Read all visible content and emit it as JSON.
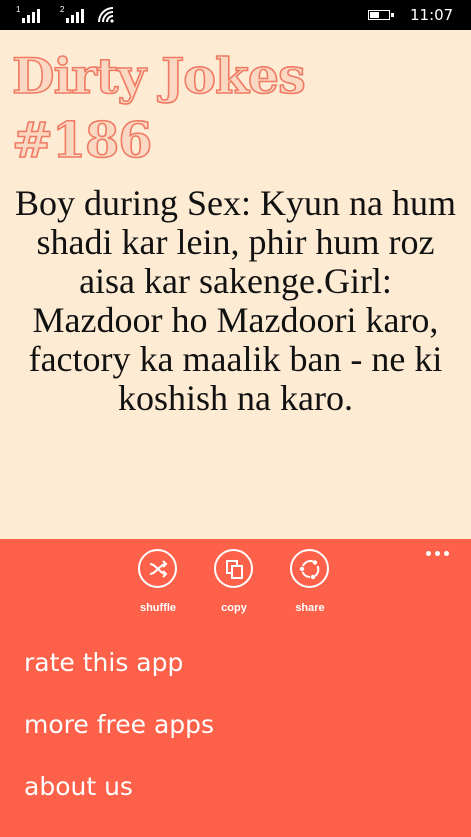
{
  "status_bar": {
    "signal_1_tag": "1",
    "signal_2_tag": "2",
    "time": "11:07"
  },
  "title": "Dirty Jokes #186",
  "joke_text": "Boy during Sex: Kyun na hum shadi kar lein, phir hum roz aisa kar sakenge.Girl: Mazdoor ho Mazdoori karo, factory ka maalik ban - ne ki koshish na karo.",
  "colors": {
    "page_background": "#fdebd3",
    "title_fill": "#fbd8c2",
    "title_stroke": "#f07a63",
    "appbar_background": "#fe6149",
    "status_bar_background": "#000000"
  },
  "appbar": {
    "buttons": [
      {
        "label": "shuffle",
        "icon": "shuffle-icon"
      },
      {
        "label": "copy",
        "icon": "copy-icon"
      },
      {
        "label": "share",
        "icon": "share-icon"
      }
    ],
    "more_icon": "more-dots-icon",
    "menu": [
      {
        "label": "rate this app"
      },
      {
        "label": "more free apps"
      },
      {
        "label": "about us"
      }
    ]
  }
}
